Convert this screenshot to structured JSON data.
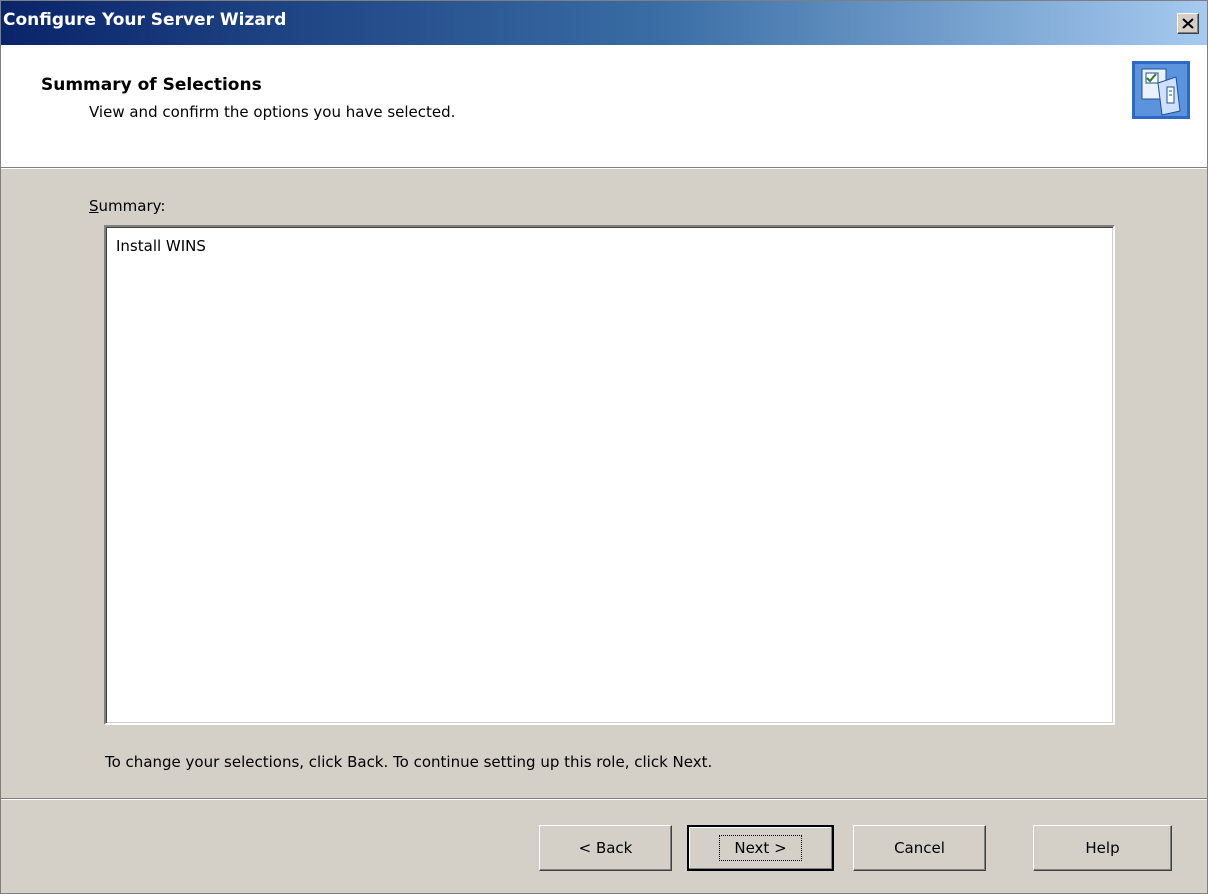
{
  "window": {
    "title": "Configure Your Server Wizard",
    "close_symbol": "×"
  },
  "header": {
    "title": "Summary of Selections",
    "subtitle": "View and confirm the options you have selected.",
    "icon": "wizard-clipboard-icon"
  },
  "summary": {
    "label": "Summary:",
    "items": [
      "Install WINS"
    ]
  },
  "hint": "To change your selections, click Back. To continue setting up this role, click Next.",
  "buttons": {
    "back": "< Back",
    "next": "Next >",
    "cancel": "Cancel",
    "help": "Help"
  },
  "colors": {
    "titlebar_start": "#0a246a",
    "titlebar_end": "#a6caf0",
    "dialog_face": "#d4d0c8"
  }
}
